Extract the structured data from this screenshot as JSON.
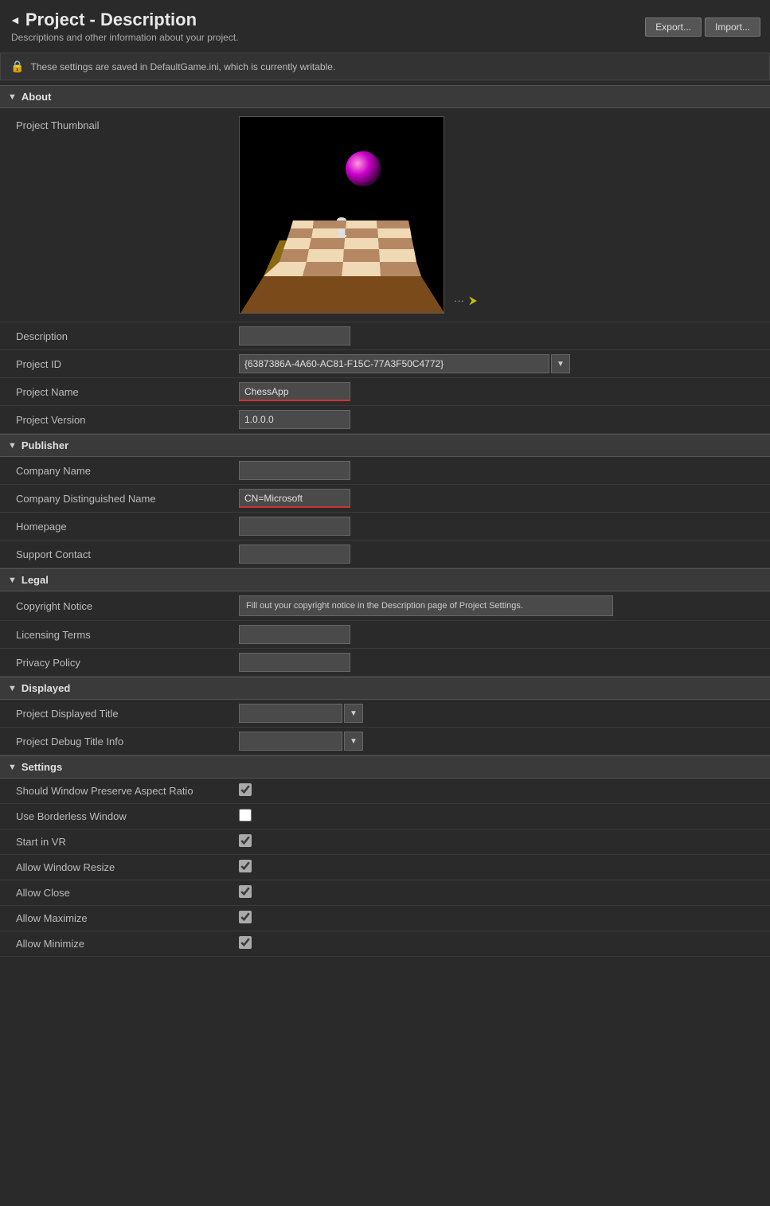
{
  "page": {
    "title": "Project - Description",
    "subtitle": "Descriptions and other information about your project.",
    "notice": "These settings are saved in DefaultGame.ini, which is currently writable.",
    "export_label": "Export...",
    "import_label": "Import..."
  },
  "sections": {
    "about": {
      "label": "About",
      "fields": {
        "thumbnail_label": "Project Thumbnail",
        "description_label": "Description",
        "description_value": "",
        "project_id_label": "Project ID",
        "project_id_value": "{6387386A-4A60-AC81-F15C-77A3F50C4772}",
        "project_name_label": "Project Name",
        "project_name_value": "ChessApp",
        "project_version_label": "Project Version",
        "project_version_value": "1.0.0.0"
      }
    },
    "publisher": {
      "label": "Publisher",
      "fields": {
        "company_name_label": "Company Name",
        "company_name_value": "",
        "company_dn_label": "Company Distinguished Name",
        "company_dn_value": "CN=Microsoft",
        "homepage_label": "Homepage",
        "homepage_value": "",
        "support_label": "Support Contact",
        "support_value": ""
      }
    },
    "legal": {
      "label": "Legal",
      "fields": {
        "copyright_label": "Copyright Notice",
        "copyright_value": "Fill out your copyright notice in the Description page of Project Settings.",
        "licensing_label": "Licensing Terms",
        "licensing_value": "",
        "privacy_label": "Privacy Policy",
        "privacy_value": ""
      }
    },
    "displayed": {
      "label": "Displayed",
      "fields": {
        "title_label": "Project Displayed Title",
        "title_value": "",
        "debug_label": "Project Debug Title Info",
        "debug_value": ""
      }
    },
    "settings": {
      "label": "Settings",
      "fields": {
        "aspect_ratio_label": "Should Window Preserve Aspect Ratio",
        "aspect_ratio_checked": true,
        "borderless_label": "Use Borderless Window",
        "borderless_checked": false,
        "start_vr_label": "Start in VR",
        "start_vr_checked": true,
        "allow_resize_label": "Allow Window Resize",
        "allow_resize_checked": true,
        "allow_close_label": "Allow Close",
        "allow_close_checked": true,
        "allow_maximize_label": "Allow Maximize",
        "allow_maximize_checked": true,
        "allow_minimize_label": "Allow Minimize",
        "allow_minimize_checked": true
      }
    }
  }
}
